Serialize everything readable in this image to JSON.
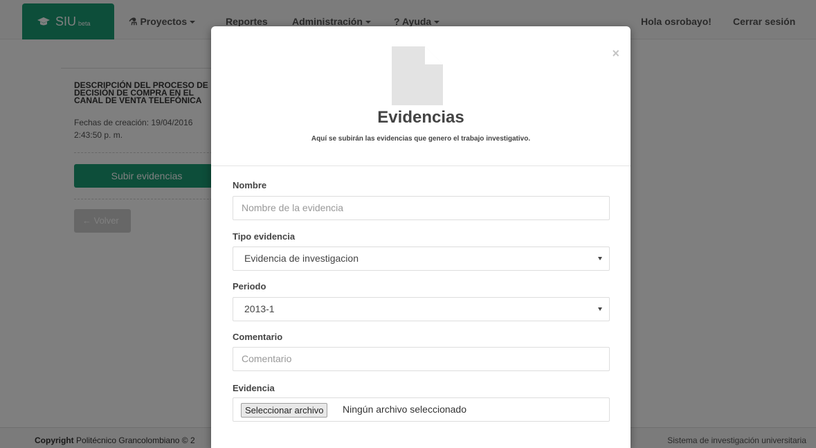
{
  "brand": {
    "name": "SIU",
    "tag": "beta",
    "icon": "graduation-cap-icon"
  },
  "nav": {
    "proyectos": "Proyectos",
    "reportes": "Reportes",
    "administracion": "Administración",
    "ayuda": "Ayuda",
    "ayuda_prefix": "?",
    "greeting": "Hola osrobayo!",
    "logout": "Cerrar sesión"
  },
  "page": {
    "project_title": "DESCRIPCIÓN DEL PROCESO DE DECISIÓN DE COMPRA EN EL CANAL DE VENTA TELEFÓNICA",
    "date_line": "Fechas de creación: 19/04/2016 2:43:50 p. m.",
    "upload_button": "Subir evidencias",
    "back_button": "Volver",
    "back_arrow": "←"
  },
  "footer": {
    "copyright_bold": "Copyright",
    "copyright_text": "Politécnico Grancolombiano © 2",
    "right": "Sistema de investigación universitaria"
  },
  "modal": {
    "close": "×",
    "title": "Evidencias",
    "subtitle": "Aquí se subirán las evidencias que genero el trabajo investigativo.",
    "fields": {
      "nombre_label": "Nombre",
      "nombre_placeholder": "Nombre de la evidencia",
      "tipo_label": "Tipo evidencia",
      "tipo_value": "Evidencia de investigacion",
      "periodo_label": "Periodo",
      "periodo_value": "2013-1",
      "comentario_label": "Comentario",
      "comentario_placeholder": "Comentario",
      "evidencia_label": "Evidencia",
      "file_button": "Seleccionar archivo",
      "file_status": "Ningún archivo seleccionado"
    }
  },
  "colors": {
    "brand": "#1a9c74",
    "backdrop": "rgba(0,0,0,0.5)"
  }
}
